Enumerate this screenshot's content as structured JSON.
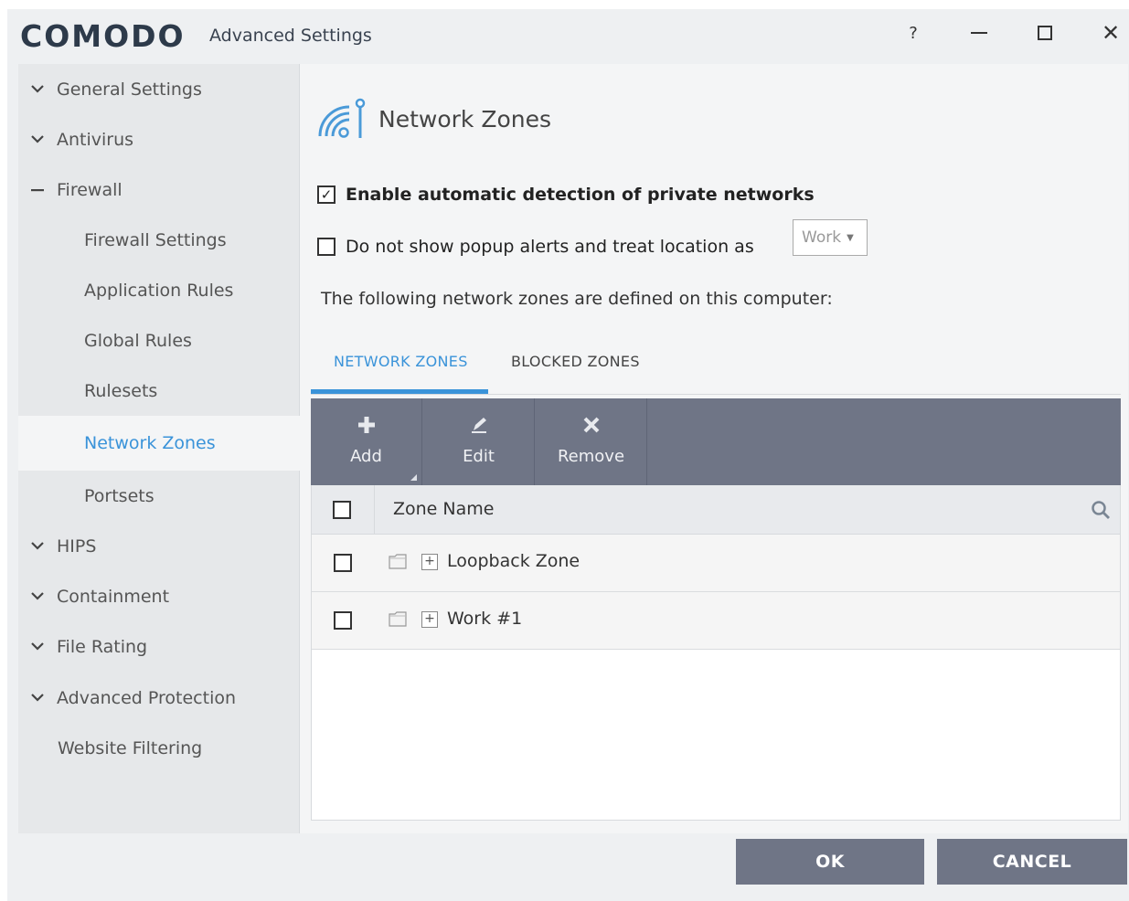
{
  "window": {
    "logo": "COMODO",
    "title": "Advanced Settings",
    "help": "?"
  },
  "sidebar": {
    "items": [
      {
        "label": "General Settings"
      },
      {
        "label": "Antivirus"
      },
      {
        "label": "Firewall"
      },
      {
        "label": "Firewall Settings"
      },
      {
        "label": "Application Rules"
      },
      {
        "label": "Global Rules"
      },
      {
        "label": "Rulesets"
      },
      {
        "label": "Network Zones"
      },
      {
        "label": "Portsets"
      },
      {
        "label": "HIPS"
      },
      {
        "label": "Containment"
      },
      {
        "label": "File Rating"
      },
      {
        "label": "Advanced Protection"
      },
      {
        "label": "Website Filtering"
      }
    ]
  },
  "main": {
    "title": "Network Zones",
    "enable_auto_detect": {
      "label": "Enable automatic detection of private networks",
      "checked": true
    },
    "no_popup": {
      "label": "Do not show popup alerts and treat location as",
      "checked": false
    },
    "location_select": {
      "value": "Work"
    },
    "info": "The following network zones are defined on this computer:",
    "tabs": [
      {
        "label": "NETWORK ZONES",
        "active": true
      },
      {
        "label": "BLOCKED ZONES",
        "active": false
      }
    ],
    "toolbar": {
      "add": "Add",
      "edit": "Edit",
      "remove": "Remove"
    },
    "table": {
      "column": "Zone Name",
      "rows": [
        {
          "name": "Loopback Zone"
        },
        {
          "name": "Work #1"
        }
      ]
    }
  },
  "footer": {
    "ok": "OK",
    "cancel": "CANCEL"
  },
  "colors": {
    "accent": "#3a93d9",
    "toolbar": "#6f7586"
  }
}
